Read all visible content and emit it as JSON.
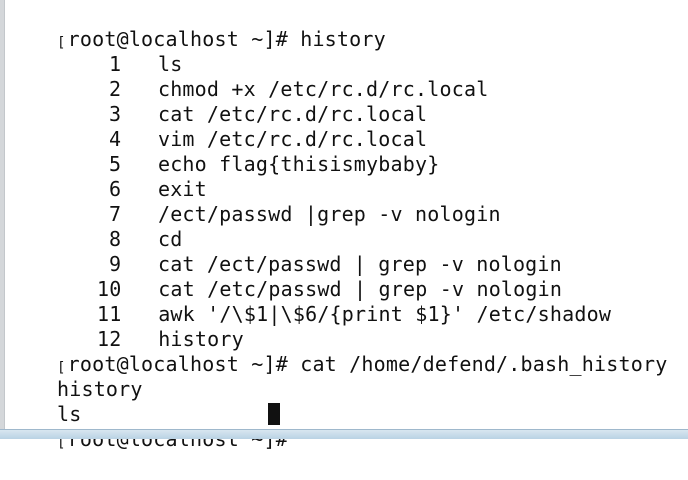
{
  "terminal": {
    "lines": [
      {
        "kind": "prompt",
        "prompt": "root@localhost ~]#",
        "command": "history"
      },
      {
        "kind": "history",
        "num": "1",
        "cmd": "ls"
      },
      {
        "kind": "history",
        "num": "2",
        "cmd": "chmod +x /etc/rc.d/rc.local"
      },
      {
        "kind": "history",
        "num": "3",
        "cmd": "cat /etc/rc.d/rc.local"
      },
      {
        "kind": "history",
        "num": "4",
        "cmd": "vim /etc/rc.d/rc.local"
      },
      {
        "kind": "history",
        "num": "5",
        "cmd": "echo flag{thisismybaby}"
      },
      {
        "kind": "history",
        "num": "6",
        "cmd": "exit"
      },
      {
        "kind": "history",
        "num": "7",
        "cmd": "/ect/passwd |grep -v nologin"
      },
      {
        "kind": "history",
        "num": "8",
        "cmd": "cd"
      },
      {
        "kind": "history",
        "num": "9",
        "cmd": "cat /ect/passwd | grep -v nologin"
      },
      {
        "kind": "history",
        "num": "10",
        "cmd": "cat /etc/passwd | grep -v nologin"
      },
      {
        "kind": "history",
        "num": "11",
        "cmd": "awk '/\\$1|\\$6/{print $1}' /etc/shadow"
      },
      {
        "kind": "history",
        "num": "12",
        "cmd": "history"
      },
      {
        "kind": "prompt",
        "prompt": "root@localhost ~]#",
        "command": "cat /home/defend/.bash_history"
      },
      {
        "kind": "output",
        "text": "history"
      },
      {
        "kind": "output",
        "text": "ls"
      },
      {
        "kind": "prompt",
        "prompt": "root@localhost ~]#",
        "command": ""
      }
    ],
    "bracket_char": "["
  }
}
